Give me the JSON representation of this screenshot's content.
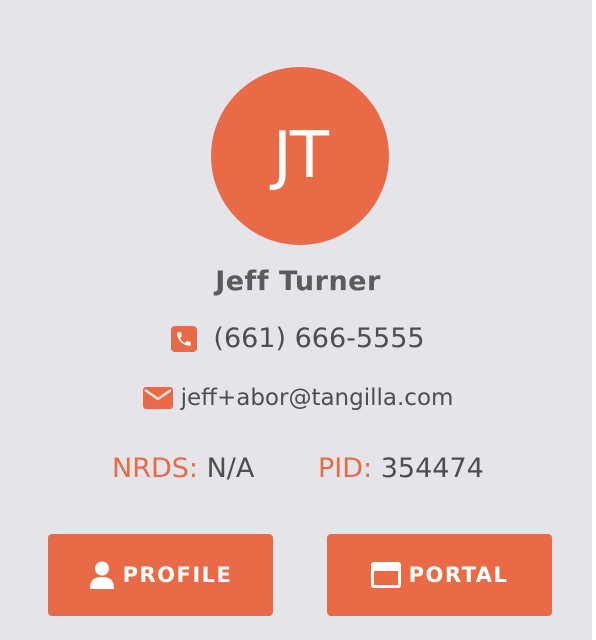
{
  "agent": {
    "initials": "JT",
    "name": "Jeff Turner",
    "phone": "(661) 666-5555",
    "email": "jeff+abor@tangilla.com",
    "nrds_label": "NRDS:",
    "nrds_value": "N/A",
    "pid_label": "PID:",
    "pid_value": "354474"
  },
  "buttons": {
    "profile_label": "PROFILE",
    "portal_label": "PORTAL"
  },
  "icons": {
    "phone": "phone-icon",
    "email": "envelope-icon",
    "profile": "user-icon",
    "portal": "credit-card-icon"
  },
  "colors": {
    "accent": "#e86a47",
    "background": "#e4e4e9",
    "text": "#4e4e4e"
  }
}
